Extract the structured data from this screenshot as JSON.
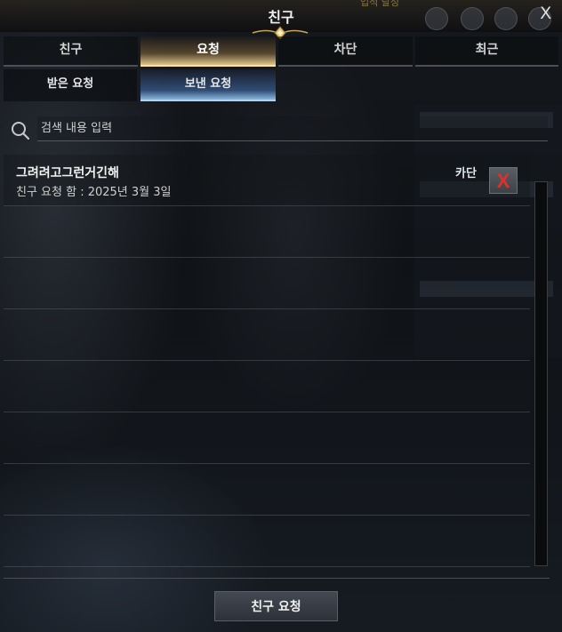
{
  "window": {
    "title": "친구",
    "close_label": "X"
  },
  "background": {
    "gold_text": "업적 달성"
  },
  "tabs": [
    {
      "label": "친구",
      "active": false
    },
    {
      "label": "요청",
      "active": true
    },
    {
      "label": "차단",
      "active": false
    },
    {
      "label": "최근",
      "active": false
    }
  ],
  "subtabs": [
    {
      "label": "받은 요청",
      "active": false
    },
    {
      "label": "보낸 요청",
      "active": true
    }
  ],
  "search": {
    "placeholder": "검색 내용 입력",
    "icon": "search-icon"
  },
  "requests": [
    {
      "name": "그려려고그런거긴해",
      "date_text": "친구 요청 함 : 2025년 3월 3일",
      "server": "카단",
      "cancel_label": "X"
    }
  ],
  "footer": {
    "send_request_label": "친구 요청"
  },
  "colors": {
    "active_tab_accent": "#f7e2ae",
    "active_subtab_accent": "#a9d4f5",
    "cancel_x": "#e0302a"
  }
}
